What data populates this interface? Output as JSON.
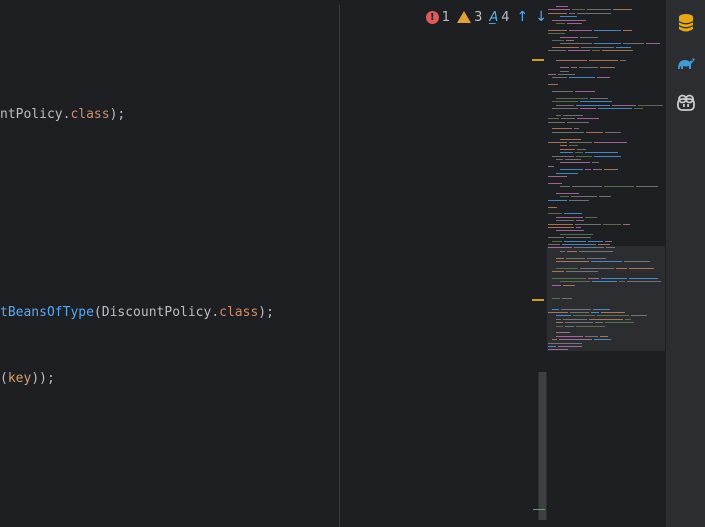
{
  "editor": {
    "line1": {
      "tail": "ntPolicy",
      "dot": ".",
      "kw": "class",
      "end": ");"
    },
    "line2": {
      "fn": "tBeansOfType",
      "open": "(",
      "cls": "DiscountPolicy",
      "dot": ".",
      "kw": "class",
      "end": ");"
    },
    "line3": {
      "open": "(",
      "param": "key",
      "end": "));"
    }
  },
  "inspections": {
    "errors": "1",
    "warnings": "3",
    "typos": "4"
  },
  "icons": {
    "error": "error-icon",
    "warning": "warning-icon",
    "typo": "typo-icon",
    "prev": "arrow-up-icon",
    "next": "arrow-down-icon",
    "database": "database-icon",
    "gradle": "gradle-icon",
    "copilot": "copilot-icon"
  },
  "colors": {
    "background": "#1e1f22",
    "keyword": "#cf8e6d",
    "function": "#56a8f5",
    "error": "#db5c5c",
    "warning": "#e0a23a",
    "database": "#e6a817",
    "gradle": "#3d9bd6"
  }
}
